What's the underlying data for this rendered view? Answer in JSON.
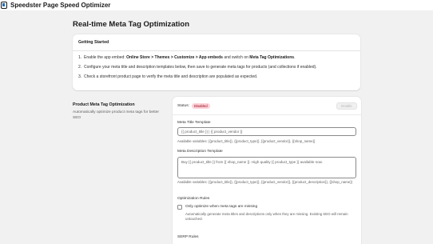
{
  "app": {
    "title": "Speedster Page Speed Optimizer"
  },
  "page": {
    "title": "Real-time Meta Tag Optimization"
  },
  "getting_started": {
    "heading": "Getting Started",
    "steps": [
      {
        "num": "1.",
        "pre": "Enable the app embed: ",
        "bold": "Online Store > Themes > Customize > App embeds",
        "mid": " and switch on ",
        "bold2": "Meta Tag Optimizations",
        "post": "."
      },
      {
        "num": "2.",
        "text": "Configure your meta title and description templates below, then save to generate meta tags for products (and collections if enabled)."
      },
      {
        "num": "3.",
        "text": "Check a storefront product page to verify the meta title and description are populated as expected."
      }
    ]
  },
  "product_section": {
    "title": "Product Meta Tag Optimization",
    "description": "Automatically optimize product meta tags for better SEO"
  },
  "settings": {
    "status_label": "Status:",
    "status_badge": "Disabled",
    "enable_button": "Enable",
    "meta_title_label": "Meta Title Template",
    "meta_title_value": "{{ product_title }} | {{ product_vendor }}",
    "meta_title_help": "Available variables: {{product_title}}, {{product_type}}, {{product_vendor}}, {{shop_name}}",
    "meta_desc_label": "Meta Description Template",
    "meta_desc_value": "Buy {{ product_title }} from {{ shop_name }}. High quality {{ product_type }} available now.",
    "meta_desc_help": "Available variables: {{product_title}}, {{product_type}}, {{product_vendor}}, {{product_description}}, {{shop_name}}",
    "rules_label": "Optimization Rules",
    "only_missing_label": "Only optimize when meta tags are missing",
    "only_missing_help": "Automatically generate meta titles and descriptions only when they are missing. Existing SEO will remain untouched.",
    "only_missing_checked": false,
    "serp_label": "SERP Rules"
  }
}
